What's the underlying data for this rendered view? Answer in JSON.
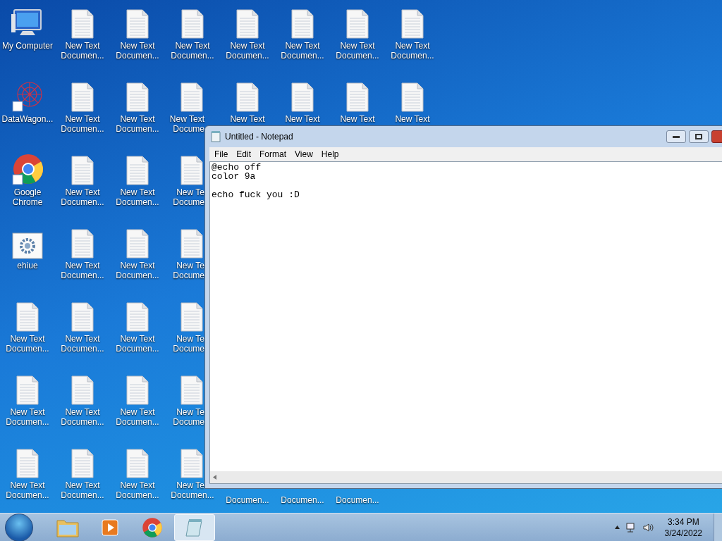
{
  "desktop": {
    "icon_columns": [
      [
        {
          "kind": "computer",
          "label": [
            "My Computer"
          ]
        },
        {
          "kind": "network-shortcut",
          "label": [
            "DataWagon..."
          ]
        },
        {
          "kind": "chrome-shortcut",
          "label": [
            "Google",
            "Chrome"
          ]
        },
        {
          "kind": "settings",
          "label": [
            "ehiue"
          ]
        },
        {
          "kind": "file",
          "label": [
            "New Text",
            "Documen..."
          ]
        },
        {
          "kind": "file",
          "label": [
            "New Text",
            "Documen..."
          ]
        },
        {
          "kind": "file",
          "label": [
            "New Text",
            "Documen..."
          ]
        }
      ],
      [
        {
          "kind": "file",
          "label": [
            "New Text",
            "Documen..."
          ]
        },
        {
          "kind": "file",
          "label": [
            "New Text",
            "Documen..."
          ]
        },
        {
          "kind": "file",
          "label": [
            "New Text",
            "Documen..."
          ]
        },
        {
          "kind": "file",
          "label": [
            "New Text",
            "Documen..."
          ]
        },
        {
          "kind": "file",
          "label": [
            "New Text",
            "Documen..."
          ]
        },
        {
          "kind": "file",
          "label": [
            "New Text",
            "Documen..."
          ]
        },
        {
          "kind": "file",
          "label": [
            "New Text",
            "Documen..."
          ]
        }
      ],
      [
        {
          "kind": "file",
          "label": [
            "New Text",
            "Documen..."
          ]
        },
        {
          "kind": "file",
          "label": [
            "New Text",
            "Documen..."
          ]
        },
        {
          "kind": "file",
          "label": [
            "New Text",
            "Documen..."
          ]
        },
        {
          "kind": "file",
          "label": [
            "New Text",
            "Documen..."
          ]
        },
        {
          "kind": "file",
          "label": [
            "New Text",
            "Documen..."
          ]
        },
        {
          "kind": "file",
          "label": [
            "New Text",
            "Documen..."
          ]
        },
        {
          "kind": "file",
          "label": [
            "New Text",
            "Documen..."
          ]
        }
      ],
      [
        {
          "kind": "file",
          "label": [
            "New Text",
            "Documen..."
          ]
        },
        {
          "kind": "file-clipped",
          "label": [
            "New Text",
            "Docume"
          ]
        },
        {
          "kind": "file-clipped",
          "label": [
            "New Te",
            "Docume"
          ]
        },
        {
          "kind": "file-clipped",
          "label": [
            "New Te",
            "Docume"
          ]
        },
        {
          "kind": "file-clipped",
          "label": [
            "New Te",
            "Docume"
          ]
        },
        {
          "kind": "file-clipped",
          "label": [
            "New Te",
            "Docume"
          ]
        },
        {
          "kind": "file-clipped-top",
          "label": [
            "New Te",
            "Documen..."
          ]
        }
      ],
      [
        {
          "kind": "file",
          "label": [
            "New Text",
            "Documen..."
          ]
        },
        {
          "kind": "file",
          "label": [
            "New Text"
          ]
        },
        {
          "kind": "hidden"
        },
        {
          "kind": "hidden"
        },
        {
          "kind": "hidden"
        },
        {
          "kind": "hidden"
        },
        {
          "kind": "label-only",
          "label": [
            "Documen..."
          ]
        }
      ],
      [
        {
          "kind": "file",
          "label": [
            "New Text",
            "Documen..."
          ]
        },
        {
          "kind": "file",
          "label": [
            "New Text"
          ]
        },
        {
          "kind": "hidden"
        },
        {
          "kind": "hidden"
        },
        {
          "kind": "hidden"
        },
        {
          "kind": "hidden"
        },
        {
          "kind": "label-only",
          "label": [
            "Documen..."
          ]
        }
      ],
      [
        {
          "kind": "file",
          "label": [
            "New Text",
            "Documen..."
          ]
        },
        {
          "kind": "file",
          "label": [
            "New Text"
          ]
        },
        {
          "kind": "hidden"
        },
        {
          "kind": "hidden"
        },
        {
          "kind": "hidden"
        },
        {
          "kind": "hidden"
        },
        {
          "kind": "label-only",
          "label": [
            "Documen..."
          ]
        }
      ],
      [
        {
          "kind": "file",
          "label": [
            "New Text",
            "Documen..."
          ]
        },
        {
          "kind": "file",
          "label": [
            "New Text"
          ]
        }
      ]
    ]
  },
  "window": {
    "title": "Untitled - Notepad",
    "menu": [
      "File",
      "Edit",
      "Format",
      "View",
      "Help"
    ],
    "text": "@echo off\ncolor 9a\n\necho fuck you :D"
  },
  "taskbar": {
    "apps": [
      {
        "kind": "folder",
        "selected": false
      },
      {
        "kind": "media",
        "selected": false
      },
      {
        "kind": "chrome",
        "selected": false
      },
      {
        "kind": "notepad",
        "selected": true
      }
    ],
    "time": "3:34 PM",
    "date": "3/24/2022"
  }
}
